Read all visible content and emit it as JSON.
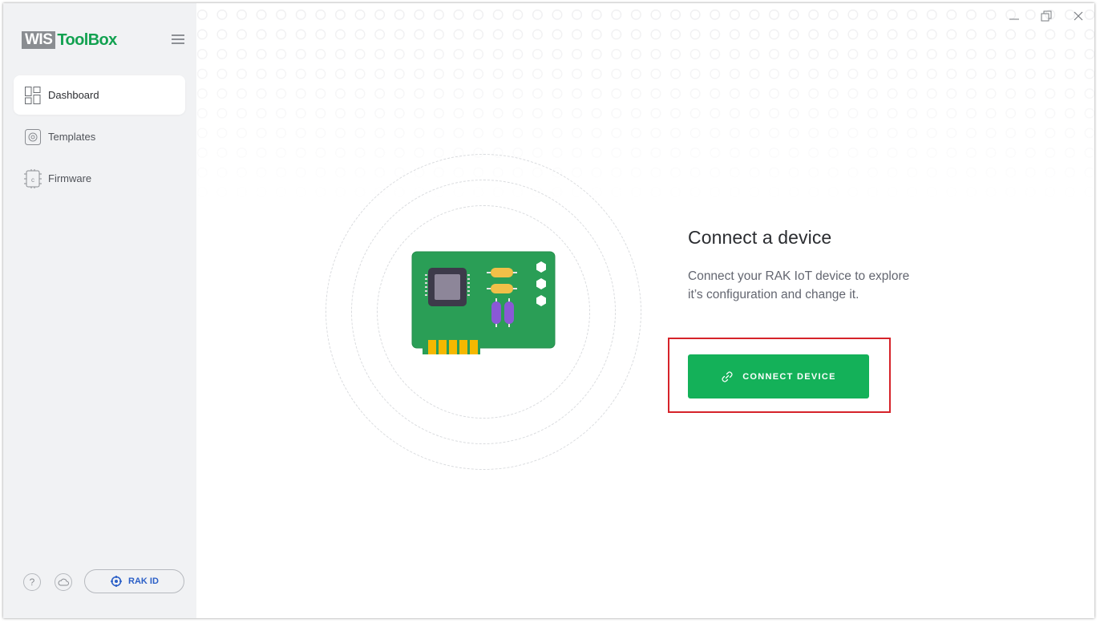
{
  "app": {
    "logo_box": "WIS",
    "logo_text": "ToolBox"
  },
  "sidebar": {
    "items": [
      {
        "label": "Dashboard",
        "icon": "dashboard-icon",
        "active": true
      },
      {
        "label": "Templates",
        "icon": "templates-icon",
        "active": false
      },
      {
        "label": "Firmware",
        "icon": "firmware-chip-icon",
        "active": false
      }
    ],
    "help_label": "?",
    "rak_id_label": "RAK ID"
  },
  "main": {
    "title": "Connect a device",
    "description": "Connect your RAK IoT device to explore it’s configuration and change it.",
    "connect_button": "CONNECT DEVICE"
  },
  "colors": {
    "brand_green": "#12a150",
    "button_green": "#14b159",
    "highlight_red": "#d6232a",
    "rak_blue": "#2b5fc7"
  }
}
